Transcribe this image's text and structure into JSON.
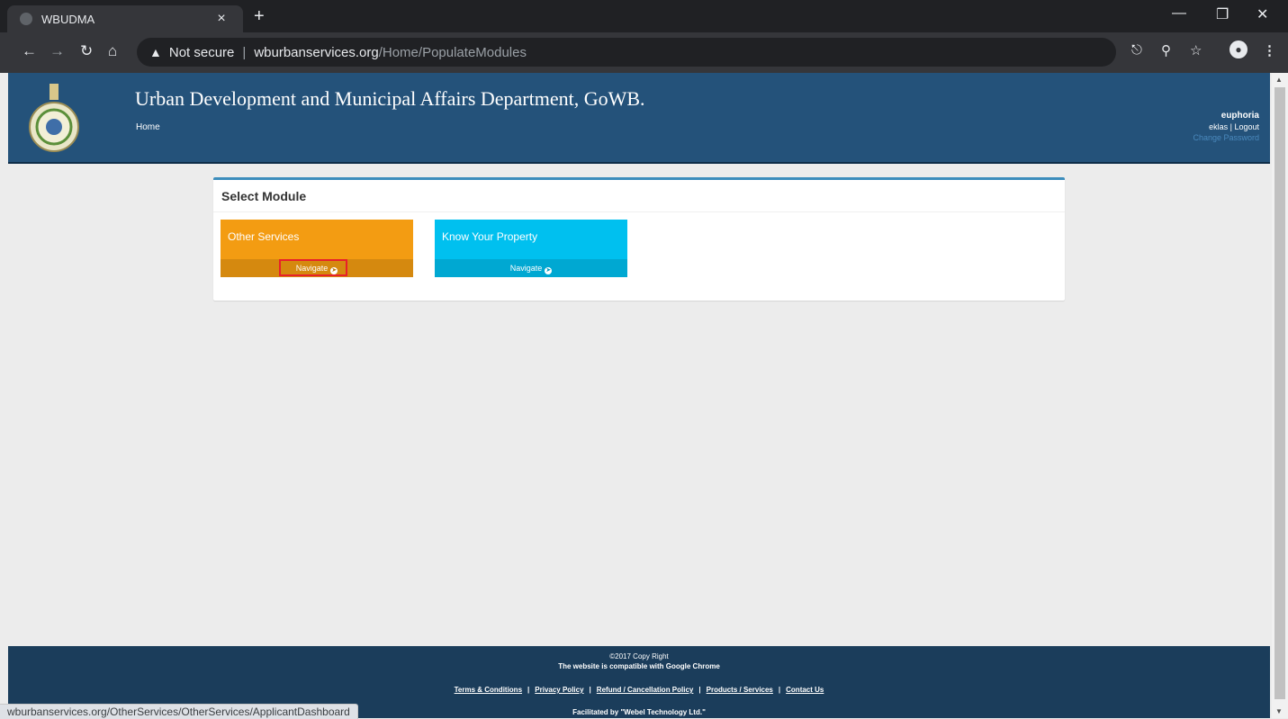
{
  "browser": {
    "tab_title": "WBUDMA",
    "tab_close": "×",
    "new_tab": "+",
    "security_label": "Not secure",
    "url_host": "wburbanservices.org",
    "url_path": "/Home/PopulateModules",
    "status_url": "wburbanservices.org/OtherServices/OtherServices/ApplicantDashboard"
  },
  "header": {
    "title": "Urban Development and Municipal Affairs Department, GoWB.",
    "home_link": "Home",
    "user": {
      "name": "euphoria",
      "account": "eklas",
      "logout": "Logout",
      "change_password": "Change Password"
    }
  },
  "panel": {
    "title": "Select Module",
    "modules": [
      {
        "label": "Other Services",
        "action": "Navigate",
        "color": "#f39c12"
      },
      {
        "label": "Know Your Property",
        "action": "Navigate",
        "color": "#00c0ef"
      }
    ]
  },
  "footer": {
    "copyright": "©2017 Copy Right",
    "compat": "The website is compatible with Google Chrome",
    "links": [
      "Terms & Conditions",
      "Privacy Policy",
      "Refund / Cancellation Policy",
      "Products / Services",
      "Contact Us"
    ],
    "facilitated": "Facilitated by \"Webel Technology Ltd.\""
  },
  "colors": {
    "header_bg": "#24527a",
    "footer_bg": "#1b3d5b",
    "highlight": "#e8202a"
  }
}
